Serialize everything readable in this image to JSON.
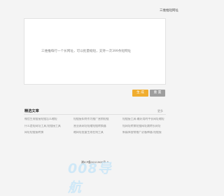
{
  "header": {
    "link_text": "三维推短网址"
  },
  "input": {
    "placeholder": "三维推每行一个长网址，可以批量缩短，支持一次399条短网址"
  },
  "buttons": {
    "generate": "生 成",
    "reset": "重 置"
  },
  "section": {
    "title": "精选文章",
    "more": "更多",
    "articles": [
      "微信生成链接短链怎么缩短",
      "短链接如何作为推广营销短链",
      "短链接工具:最好用的中长网址缩短",
      "什么是短网址工具,短链接工具",
      "营业表网址短缩短链转换器",
      "短网址转换短链网址跳转长网址",
      "网址短链接转换",
      "缩网址批量生成在线工具",
      "新媒体营销推广必备神器:短链接"
    ]
  },
  "footer": {
    "icp": "湘ICP备2011909号-8"
  },
  "logo": {
    "text": "008导航"
  }
}
